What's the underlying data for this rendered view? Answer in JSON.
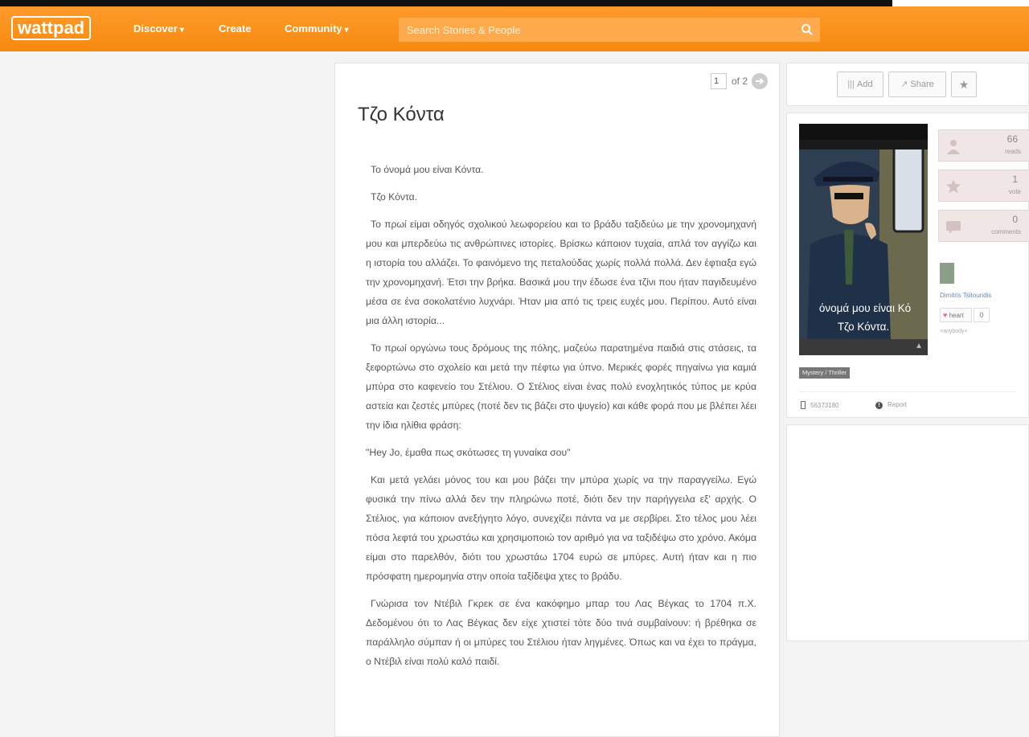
{
  "header": {
    "logo": "wattpad",
    "nav": [
      "Discover",
      "Create",
      "Community"
    ],
    "search_placeholder": "Search Stories & People"
  },
  "reader": {
    "page_current": "1",
    "page_total_text": "of 2",
    "title": "Τζο Κόντα",
    "paragraphs": [
      "Το όνομά μου είναι Κόντα.",
      "Τζο Κόντα.",
      "Το πρωί είμαι οδηγός σχολικού λεωφορείου και το βράδυ ταξιδεύω με την χρονομηχανή μου και μπερδεύω τις ανθρώπινες ιστορίες. Βρίσκω κάποιον τυχαία, απλά τον αγγίζω και η ιστορία του αλλάζει. Το φαινόμενο της πεταλούδας χωρίς πολλά πολλά. Δεν έφτιαξα εγώ την χρονομηχανή. Έτσι την βρήκα. Βασικά μου την έδωσε ένα τζίνι που ήταν παγιδευμένο μέσα σε ένα σοκολατένιο λυχνάρι. Ήταν μια από τις τρεις ευχές μου. Περίπου. Αυτό είναι μια άλλη ιστορία...",
      "Το πρωί οργώνω τους δρόμους της πόλης, μαζεύω παρατημένα παιδιά στις στάσεις, τα ξεφορτώνω στο σχολείο και μετά την πέφτω για ύπνο. Μερικές φορές πηγαίνω για καμιά μπύρα στο καφενείο του Στέλιου. Ο Στέλιος είναι ένας πολύ ενοχλητικός τύπος με κρύα αστεία και ζεστές μπύρες (ποτέ δεν τις βάζει στο ψυγείο) και κάθε φορά που με βλέπει λέει την ίδια ηλίθια φράση:",
      "\"Hey Jo, έμαθα πως σκότωσες τη γυναίκα σου\"",
      "Και μετά γελάει μόνος του και μου βάζει την μπύρα χωρίς να την παραγγείλω. Εγώ φυσικά την πίνω αλλά δεν την πληρώνω ποτέ, διότι δεν την παρήγγειλα εξ' αρχής. Ο Στέλιος, για κάποιον ανεξήγητο λόγο, συνεχίζει πάντα να με σερβίρει. Στο τέλος μου λέει πόσα λεφτά του χρωστάω και χρησιμοποιώ τον αριθμό για να ταξιδέψω στο χρόνο. Ακόμα είμαι στο παρελθόν, διότι του χρωστάω 1704 ευρώ σε μπύρες. Αυτή ήταν και η πιο πρόσφατη ημερομηνία στην οποία ταξίδεψα χτες το βράδυ.",
      "Γνώρισα τον Ντέβιλ Γκρεκ σε ένα κακόφημο μπαρ του Λας Βέγκας το 1704 π.Χ. Δεδομένου ότι το Λας Βέγκας δεν είχε χτιστεί τότε δύο τινά συμβαίνουν: ή βρέθηκα σε παράλληλο σύμπαν ή οι μπύρες του Στέλιου ήταν ληγμένες. Όπως και να έχει το πράγμα, ο Ντέβιλ είναι πολύ καλό παιδί."
    ]
  },
  "sidebar": {
    "actions": {
      "add": "Add",
      "share": "Share"
    },
    "cover": {
      "line1": "όνομά μου είναι Κό",
      "line2": "Τζο Κόντα."
    },
    "stats": [
      {
        "num": "66",
        "label": "reads"
      },
      {
        "num": "1",
        "label": "vote"
      },
      {
        "num": "0",
        "label": "comments"
      }
    ],
    "author": {
      "name": "Dimitris Tsitouridis",
      "heart_label": "heart",
      "heart_count": "0",
      "extra": "+anybody+"
    },
    "genre": "Mystery / Thriller",
    "story_id": "56373180",
    "report": "Report",
    "colors": {
      "brand": "#f58a10",
      "stat_bg": "#f1e6e6",
      "author_link": "#6b88b0"
    }
  }
}
